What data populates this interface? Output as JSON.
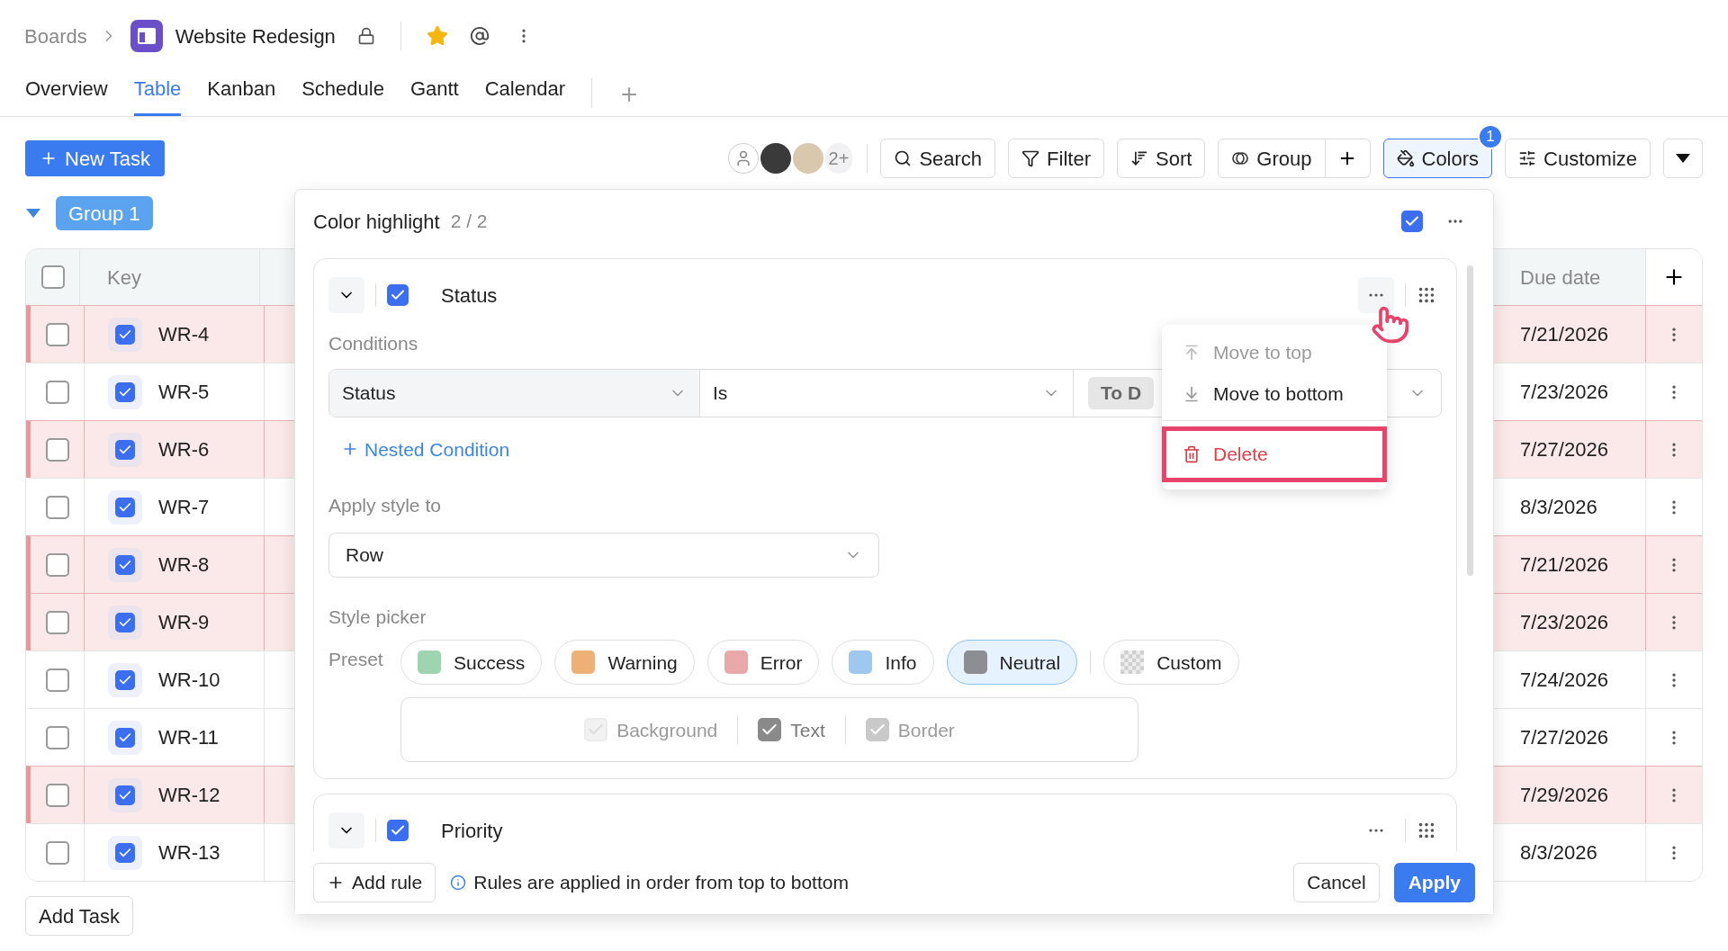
{
  "breadcrumb": {
    "root": "Boards",
    "board": "Website Redesign",
    "starred": true
  },
  "tabs": [
    {
      "label": "Overview",
      "selected": false
    },
    {
      "label": "Table",
      "selected": true
    },
    {
      "label": "Kanban",
      "selected": false
    },
    {
      "label": "Schedule",
      "selected": false
    },
    {
      "label": "Gantt",
      "selected": false
    },
    {
      "label": "Calendar",
      "selected": false
    }
  ],
  "toolbar": {
    "new_task": "New Task",
    "avatar_overflow": "2+",
    "buttons": [
      {
        "label": "Search",
        "kind": "search"
      },
      {
        "label": "Filter",
        "kind": "filter"
      },
      {
        "label": "Sort",
        "kind": "sort"
      },
      {
        "label": "Group",
        "kind": "group"
      }
    ],
    "colors": {
      "label": "Colors",
      "badge": "1",
      "selected": true
    },
    "customize": "Customize"
  },
  "group": {
    "label": "Group 1",
    "expanded": true
  },
  "table": {
    "all_checked": false,
    "columns": [
      "Key",
      "Due date"
    ],
    "rows": [
      {
        "key": "WR-4",
        "due": "7/21/2026",
        "highlighted": true,
        "checked": false,
        "key_checked": true
      },
      {
        "key": "WR-5",
        "due": "7/23/2026",
        "highlighted": false,
        "checked": false,
        "key_checked": true
      },
      {
        "key": "WR-6",
        "due": "7/27/2026",
        "highlighted": true,
        "checked": false,
        "key_checked": true
      },
      {
        "key": "WR-7",
        "due": "8/3/2026",
        "highlighted": false,
        "checked": false,
        "key_checked": true
      },
      {
        "key": "WR-8",
        "due": "7/21/2026",
        "highlighted": true,
        "checked": false,
        "key_checked": true
      },
      {
        "key": "WR-9",
        "due": "7/23/2026",
        "highlighted": true,
        "checked": false,
        "key_checked": true
      },
      {
        "key": "WR-10",
        "due": "7/24/2026",
        "highlighted": false,
        "checked": false,
        "key_checked": true
      },
      {
        "key": "WR-11",
        "due": "7/27/2026",
        "highlighted": false,
        "checked": false,
        "key_checked": true
      },
      {
        "key": "WR-12",
        "due": "7/29/2026",
        "highlighted": true,
        "checked": false,
        "key_checked": true
      },
      {
        "key": "WR-13",
        "due": "8/3/2026",
        "highlighted": false,
        "checked": false,
        "key_checked": true
      }
    ]
  },
  "add_task": "Add Task",
  "color_highlight": {
    "title": "Color highlight",
    "count": "2 / 2",
    "enabled": true,
    "rules": [
      {
        "name": "Status",
        "enabled": true,
        "conditions_label": "Conditions",
        "condition": {
          "field": "Status",
          "operator": "Is",
          "value": "To D"
        },
        "nested_link": "Nested Condition",
        "apply_label": "Apply style to",
        "apply_to": "Row",
        "style_label": "Style picker",
        "preset_label": "Preset",
        "presets": [
          {
            "label": "Success",
            "kind": "swatch",
            "color": "#9fd4b0",
            "selected": false
          },
          {
            "label": "Warning",
            "kind": "swatch",
            "color": "#eeb077",
            "selected": false
          },
          {
            "label": "Error",
            "kind": "swatch",
            "color": "#eaa9a9",
            "selected": false
          },
          {
            "label": "Info",
            "kind": "swatch",
            "color": "#9fc8f0",
            "selected": false
          },
          {
            "label": "Neutral",
            "kind": "swatch",
            "color": "#8d8d94",
            "selected": true
          },
          {
            "label": "Custom",
            "kind": "custom",
            "selected": false
          }
        ],
        "targets": [
          {
            "label": "Background",
            "checked": true,
            "disabled": true
          },
          {
            "label": "Text",
            "checked": true,
            "disabled": false
          },
          {
            "label": "Border",
            "checked": true,
            "disabled": true
          }
        ]
      },
      {
        "name": "Priority",
        "enabled": true
      }
    ],
    "menu": [
      {
        "label": "Move to top",
        "kind": "top",
        "disabled": true,
        "highlighted": false
      },
      {
        "label": "Move to bottom",
        "kind": "bottom",
        "disabled": false,
        "highlighted": false
      },
      {
        "label": "Delete",
        "kind": "delete",
        "disabled": false,
        "highlighted": true
      }
    ],
    "add_rule": "Add rule",
    "hint": "Rules are applied in order from top to bottom",
    "cancel": "Cancel",
    "apply": "Apply"
  }
}
